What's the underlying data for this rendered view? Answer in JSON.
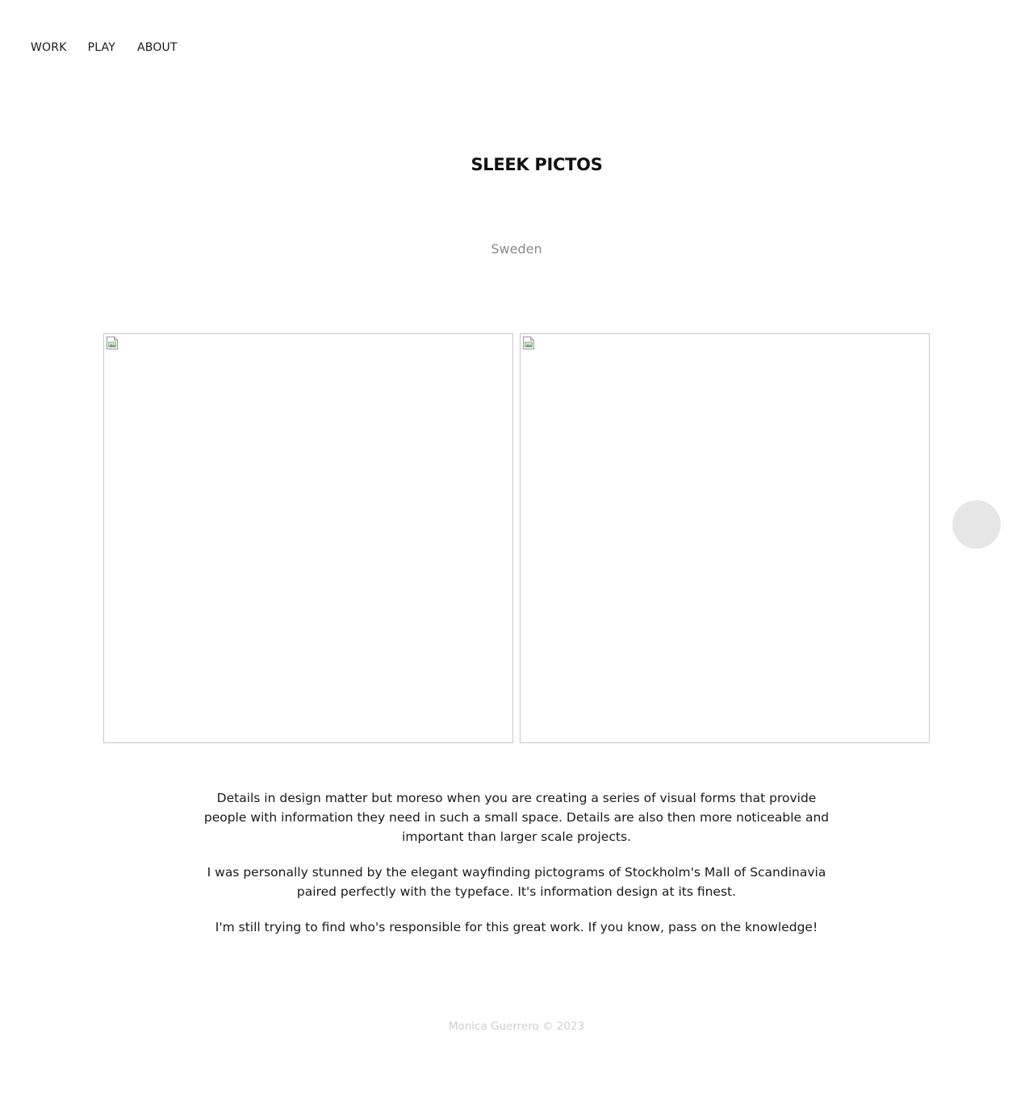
{
  "nav": {
    "items": [
      {
        "label": "WORK"
      },
      {
        "label": "PLAY"
      },
      {
        "label": "ABOUT"
      }
    ]
  },
  "project": {
    "title": "SLEEK PICTOS",
    "location": "Sweden"
  },
  "gallery": {
    "images": [
      {
        "name": "project-image-1"
      },
      {
        "name": "project-image-2"
      }
    ]
  },
  "description": {
    "paragraphs": [
      "Details in design matter but moreso when you are creating a series of visual forms that provide people with information they need in such a small space. Details are also then more noticeable and important than larger scale projects.",
      "I was personally stunned by the elegant wayfinding pictograms of Stockholm's Mall of Scandinavia paired perfectly with the typeface. It's information design at its finest.",
      "I'm still trying to find who's responsible for this great work. If you know, pass on the knowledge!"
    ]
  },
  "footer": {
    "text": "Monica Guerrero © 2023"
  },
  "colors": {
    "text": "#1a1a1a",
    "muted": "#8a8a8a",
    "footer": "#cfcfcf",
    "button": "#e6e6e6",
    "frame_border": "#c9c9c9"
  }
}
